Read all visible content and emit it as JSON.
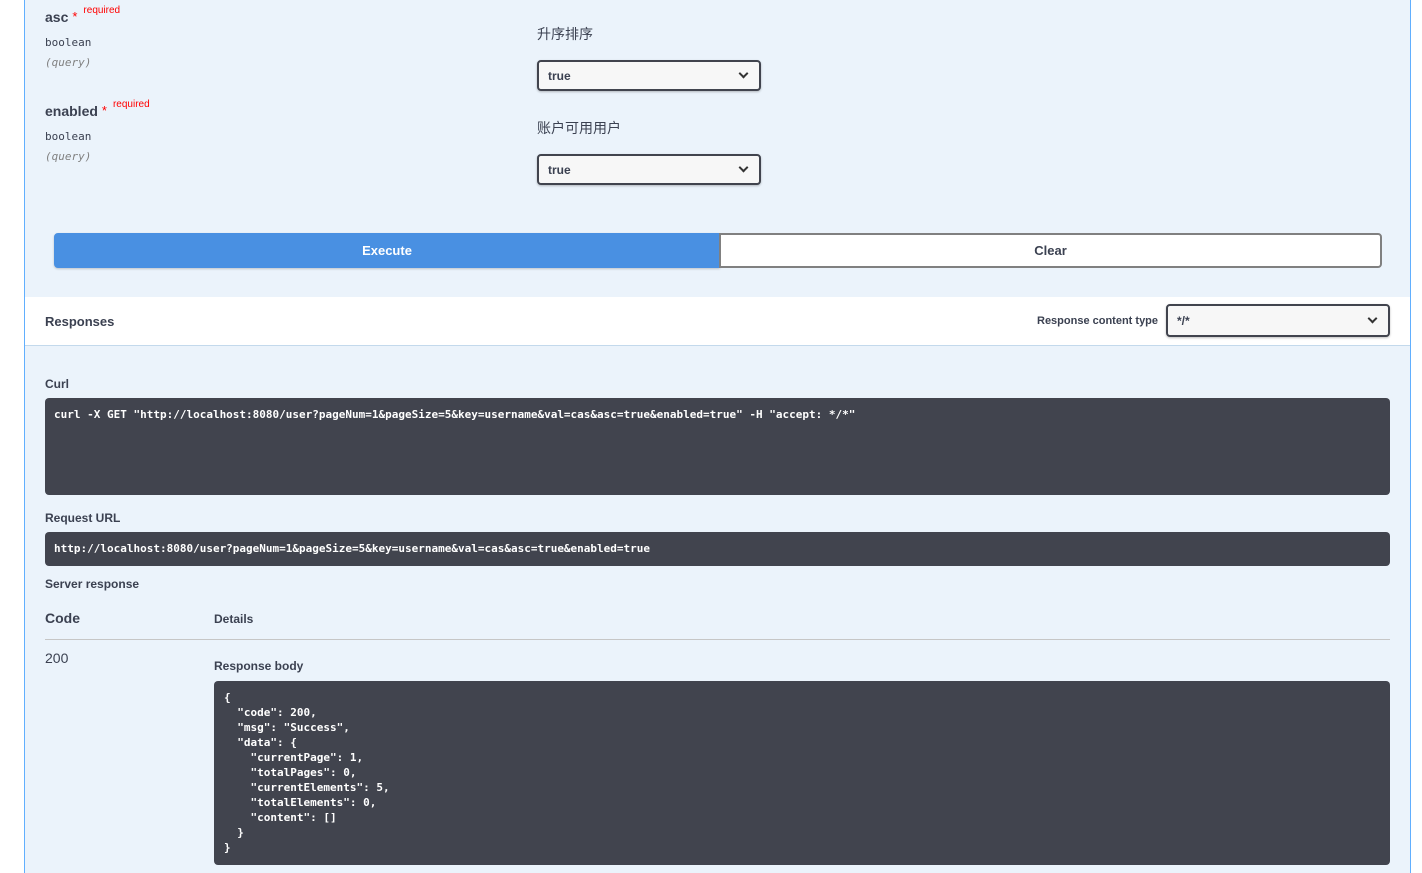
{
  "params": [
    {
      "name": "asc",
      "star": "*",
      "required_label": "required",
      "type": "boolean",
      "in": "(query)",
      "description": "升序排序",
      "selected": "true"
    },
    {
      "name": "enabled",
      "star": "*",
      "required_label": "required",
      "type": "boolean",
      "in": "(query)",
      "description": "账户可用用户",
      "selected": "true"
    }
  ],
  "buttons": {
    "execute": "Execute",
    "clear": "Clear"
  },
  "responses": {
    "title": "Responses",
    "content_type_label": "Response content type",
    "content_type_value": "*/*"
  },
  "curl": {
    "label": "Curl",
    "command": "curl -X GET \"http://localhost:8080/user?pageNum=1&pageSize=5&key=username&val=cas&asc=true&enabled=true\" -H \"accept: */*\""
  },
  "request_url": {
    "label": "Request URL",
    "value": "http://localhost:8080/user?pageNum=1&pageSize=5&key=username&val=cas&asc=true&enabled=true"
  },
  "server_response": {
    "label": "Server response",
    "col_code": "Code",
    "col_details": "Details",
    "code": "200",
    "body_label": "Response body",
    "body": "{\n  \"code\": 200,\n  \"msg\": \"Success\",\n  \"data\": {\n    \"currentPage\": 1,\n    \"totalPages\": 0,\n    \"currentElements\": 5,\n    \"totalElements\": 0,\n    \"content\": []\n  }\n}"
  }
}
